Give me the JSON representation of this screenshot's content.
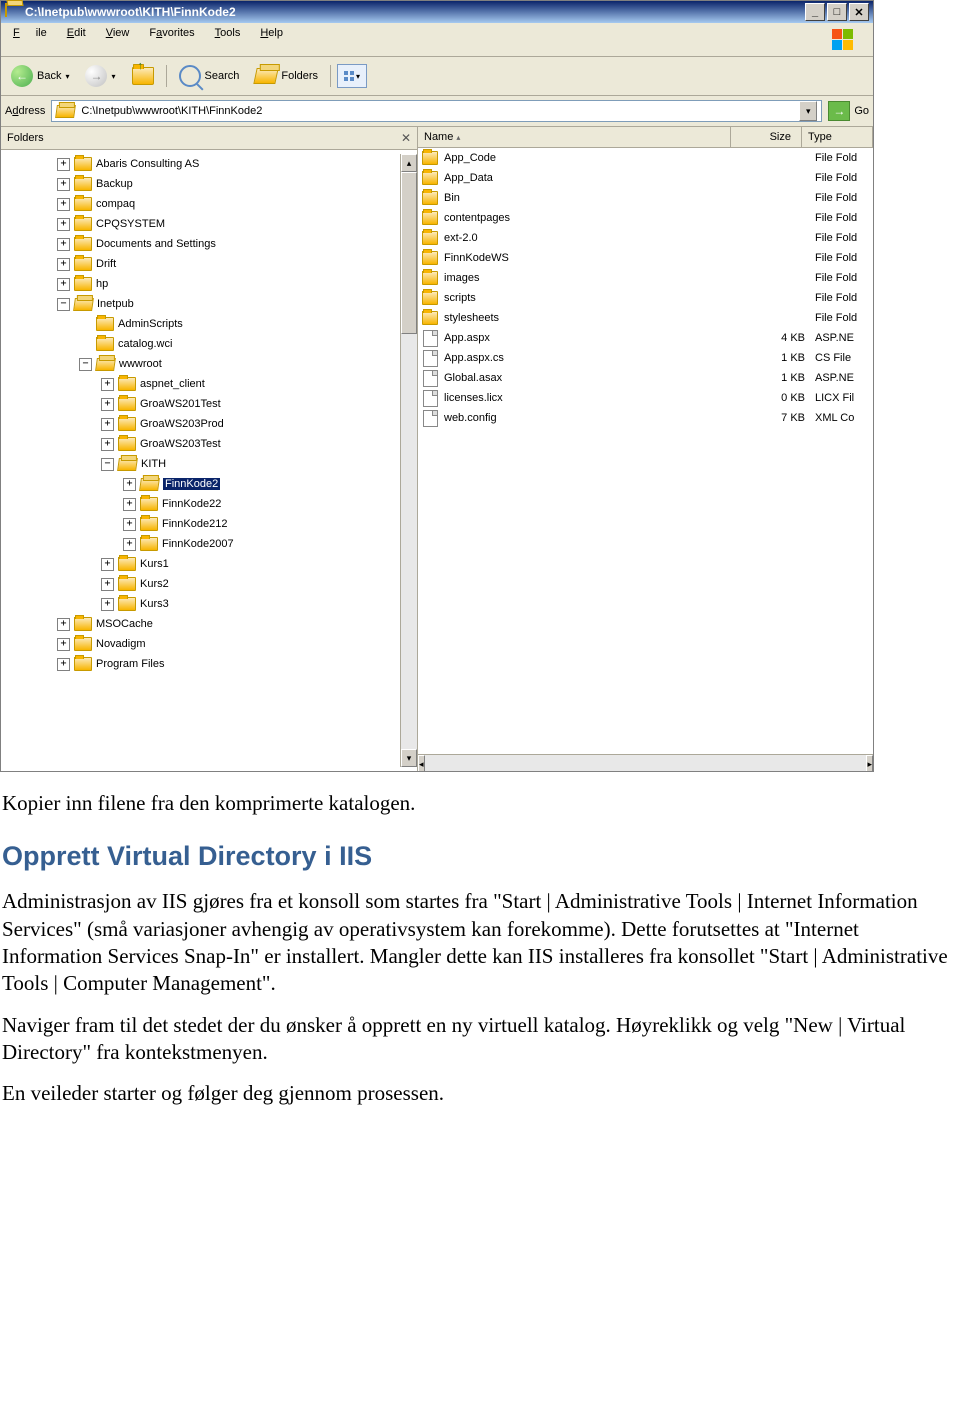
{
  "window": {
    "title": "C:\\Inetpub\\wwwroot\\KITH\\FinnKode2"
  },
  "menu": {
    "file": "File",
    "edit": "Edit",
    "view": "View",
    "favorites": "Favorites",
    "tools": "Tools",
    "help": "Help"
  },
  "toolbar": {
    "back": "Back",
    "search": "Search",
    "folders": "Folders"
  },
  "addr": {
    "label": "Address",
    "path": "C:\\Inetpub\\wwwroot\\KITH\\FinnKode2",
    "go": "Go"
  },
  "panes": {
    "folders": "Folders"
  },
  "cols": {
    "name": "Name",
    "size": "Size",
    "type": "Type"
  },
  "tree": [
    {
      "lvl": 0,
      "pm": "+",
      "open": false,
      "label": "Abaris Consulting AS"
    },
    {
      "lvl": 0,
      "pm": "+",
      "open": false,
      "label": "Backup"
    },
    {
      "lvl": 0,
      "pm": "+",
      "open": false,
      "label": "compaq"
    },
    {
      "lvl": 0,
      "pm": "+",
      "open": false,
      "label": "CPQSYSTEM"
    },
    {
      "lvl": 0,
      "pm": "+",
      "open": false,
      "label": "Documents and Settings"
    },
    {
      "lvl": 0,
      "pm": "+",
      "open": false,
      "label": "Drift"
    },
    {
      "lvl": 0,
      "pm": "+",
      "open": false,
      "label": "hp"
    },
    {
      "lvl": 0,
      "pm": "−",
      "open": true,
      "label": "Inetpub"
    },
    {
      "lvl": 1,
      "pm": "",
      "open": false,
      "label": "AdminScripts"
    },
    {
      "lvl": 1,
      "pm": "",
      "open": false,
      "label": "catalog.wci"
    },
    {
      "lvl": 1,
      "pm": "−",
      "open": true,
      "label": "wwwroot"
    },
    {
      "lvl": 2,
      "pm": "+",
      "open": false,
      "label": "aspnet_client"
    },
    {
      "lvl": 2,
      "pm": "+",
      "open": false,
      "label": "GroaWS201Test"
    },
    {
      "lvl": 2,
      "pm": "+",
      "open": false,
      "label": "GroaWS203Prod"
    },
    {
      "lvl": 2,
      "pm": "+",
      "open": false,
      "label": "GroaWS203Test"
    },
    {
      "lvl": 2,
      "pm": "−",
      "open": true,
      "label": "KITH"
    },
    {
      "lvl": 3,
      "pm": "+",
      "open": true,
      "label": "FinnKode2",
      "sel": true
    },
    {
      "lvl": 3,
      "pm": "+",
      "open": false,
      "label": "FinnKode22"
    },
    {
      "lvl": 3,
      "pm": "+",
      "open": false,
      "label": "FinnKode212"
    },
    {
      "lvl": 3,
      "pm": "+",
      "open": false,
      "label": "FinnKode2007"
    },
    {
      "lvl": 2,
      "pm": "+",
      "open": false,
      "label": "Kurs1"
    },
    {
      "lvl": 2,
      "pm": "+",
      "open": false,
      "label": "Kurs2"
    },
    {
      "lvl": 2,
      "pm": "+",
      "open": false,
      "label": "Kurs3"
    },
    {
      "lvl": 0,
      "pm": "+",
      "open": false,
      "label": "MSOCache"
    },
    {
      "lvl": 0,
      "pm": "+",
      "open": false,
      "label": "Novadigm"
    },
    {
      "lvl": 0,
      "pm": "+",
      "open": false,
      "label": "Program Files"
    }
  ],
  "files": [
    {
      "name": "App_Code",
      "size": "",
      "type": "File Fold",
      "icon": "folder"
    },
    {
      "name": "App_Data",
      "size": "",
      "type": "File Fold",
      "icon": "folder"
    },
    {
      "name": "Bin",
      "size": "",
      "type": "File Fold",
      "icon": "folder"
    },
    {
      "name": "contentpages",
      "size": "",
      "type": "File Fold",
      "icon": "folder"
    },
    {
      "name": "ext-2.0",
      "size": "",
      "type": "File Fold",
      "icon": "folder"
    },
    {
      "name": "FinnKodeWS",
      "size": "",
      "type": "File Fold",
      "icon": "folder"
    },
    {
      "name": "images",
      "size": "",
      "type": "File Fold",
      "icon": "folder"
    },
    {
      "name": "scripts",
      "size": "",
      "type": "File Fold",
      "icon": "folder"
    },
    {
      "name": "stylesheets",
      "size": "",
      "type": "File Fold",
      "icon": "folder"
    },
    {
      "name": "App.aspx",
      "size": "4 KB",
      "type": "ASP.NE",
      "icon": "aspx"
    },
    {
      "name": "App.aspx.cs",
      "size": "1 KB",
      "type": "CS File",
      "icon": "cs"
    },
    {
      "name": "Global.asax",
      "size": "1 KB",
      "type": "ASP.NE",
      "icon": "asax"
    },
    {
      "name": "licenses.licx",
      "size": "0 KB",
      "type": "LICX Fil",
      "icon": "licx"
    },
    {
      "name": "web.config",
      "size": "7 KB",
      "type": "XML Co",
      "icon": "config"
    }
  ],
  "doc": {
    "p1": "Kopier inn filene fra den komprimerte katalogen.",
    "h": "Opprett Virtual Directory i IIS",
    "p2": "Administrasjon av IIS gjøres fra et konsoll som startes fra \"Start | Administrative Tools | Internet Information Services\" (små variasjoner avhengig av operativsystem kan forekomme). Dette forutsettes at \"Internet Information Services Snap-In\" er installert. Mangler dette kan IIS installeres fra konsollet \"Start | Administrative Tools | Computer Management\".",
    "p3": "Naviger fram til det stedet der du ønsker å opprett en ny virtuell katalog. Høyreklikk og velg \"New | Virtual Directory\" fra kontekstmenyen.",
    "p4": "En veileder starter og følger deg gjennom prosessen."
  }
}
